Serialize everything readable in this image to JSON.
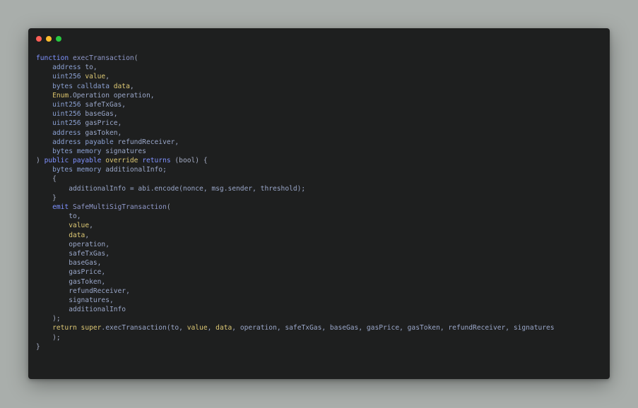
{
  "window": {
    "controls": {
      "close_color": "#ff5f57",
      "minimize_color": "#febc2e",
      "maximize_color": "#28c840"
    }
  },
  "code": {
    "lines": [
      [
        {
          "t": "kw",
          "v": "function "
        },
        {
          "t": "fn",
          "v": "execTransaction"
        },
        {
          "t": "punc",
          "v": "("
        }
      ],
      [
        {
          "t": "plain",
          "v": "    "
        },
        {
          "t": "type",
          "v": "address "
        },
        {
          "t": "plain",
          "v": "to,"
        }
      ],
      [
        {
          "t": "plain",
          "v": "    "
        },
        {
          "t": "type",
          "v": "uint256 "
        },
        {
          "t": "var",
          "v": "value"
        },
        {
          "t": "punc",
          "v": ","
        }
      ],
      [
        {
          "t": "plain",
          "v": "    "
        },
        {
          "t": "type",
          "v": "bytes calldata "
        },
        {
          "t": "var",
          "v": "data"
        },
        {
          "t": "punc",
          "v": ","
        }
      ],
      [
        {
          "t": "plain",
          "v": "    "
        },
        {
          "t": "class",
          "v": "Enum"
        },
        {
          "t": "plain",
          "v": ".Operation operation,"
        }
      ],
      [
        {
          "t": "plain",
          "v": "    "
        },
        {
          "t": "type",
          "v": "uint256 "
        },
        {
          "t": "plain",
          "v": "safeTxGas,"
        }
      ],
      [
        {
          "t": "plain",
          "v": "    "
        },
        {
          "t": "type",
          "v": "uint256 "
        },
        {
          "t": "plain",
          "v": "baseGas,"
        }
      ],
      [
        {
          "t": "plain",
          "v": "    "
        },
        {
          "t": "type",
          "v": "uint256 "
        },
        {
          "t": "plain",
          "v": "gasPrice,"
        }
      ],
      [
        {
          "t": "plain",
          "v": "    "
        },
        {
          "t": "type",
          "v": "address "
        },
        {
          "t": "plain",
          "v": "gasToken,"
        }
      ],
      [
        {
          "t": "plain",
          "v": "    "
        },
        {
          "t": "type",
          "v": "address payable "
        },
        {
          "t": "plain",
          "v": "refundReceiver,"
        }
      ],
      [
        {
          "t": "plain",
          "v": "    "
        },
        {
          "t": "type",
          "v": "bytes memory "
        },
        {
          "t": "plain",
          "v": "signatures"
        }
      ],
      [
        {
          "t": "punc",
          "v": ") "
        },
        {
          "t": "kw",
          "v": "public payable "
        },
        {
          "t": "var",
          "v": "override"
        },
        {
          "t": "kw",
          "v": " returns "
        },
        {
          "t": "punc",
          "v": "(bool) {"
        }
      ],
      [
        {
          "t": "plain",
          "v": "    "
        },
        {
          "t": "type",
          "v": "bytes memory "
        },
        {
          "t": "plain",
          "v": "additionalInfo;"
        }
      ],
      [
        {
          "t": "plain",
          "v": "    "
        },
        {
          "t": "punc",
          "v": "{"
        }
      ],
      [
        {
          "t": "plain",
          "v": "        additionalInfo = abi.encode(nonce, msg.sender, threshold);"
        }
      ],
      [
        {
          "t": "plain",
          "v": "    "
        },
        {
          "t": "punc",
          "v": "}"
        }
      ],
      [
        {
          "t": "plain",
          "v": "    "
        },
        {
          "t": "kw",
          "v": "emit "
        },
        {
          "t": "fn",
          "v": "SafeMultiSigTransaction"
        },
        {
          "t": "punc",
          "v": "("
        }
      ],
      [
        {
          "t": "plain",
          "v": "        to,"
        }
      ],
      [
        {
          "t": "plain",
          "v": "        "
        },
        {
          "t": "var",
          "v": "value"
        },
        {
          "t": "punc",
          "v": ","
        }
      ],
      [
        {
          "t": "plain",
          "v": "        "
        },
        {
          "t": "var",
          "v": "data"
        },
        {
          "t": "punc",
          "v": ","
        }
      ],
      [
        {
          "t": "plain",
          "v": "        operation,"
        }
      ],
      [
        {
          "t": "plain",
          "v": "        safeTxGas,"
        }
      ],
      [
        {
          "t": "plain",
          "v": "        baseGas,"
        }
      ],
      [
        {
          "t": "plain",
          "v": "        gasPrice,"
        }
      ],
      [
        {
          "t": "plain",
          "v": "        gasToken,"
        }
      ],
      [
        {
          "t": "plain",
          "v": "        refundReceiver,"
        }
      ],
      [
        {
          "t": "plain",
          "v": "        signatures,"
        }
      ],
      [
        {
          "t": "plain",
          "v": "        additionalInfo"
        }
      ],
      [
        {
          "t": "plain",
          "v": "    "
        },
        {
          "t": "punc",
          "v": ");"
        }
      ],
      [
        {
          "t": "plain",
          "v": "    "
        },
        {
          "t": "var",
          "v": "return super"
        },
        {
          "t": "plain",
          "v": ".execTransaction(to, "
        },
        {
          "t": "var",
          "v": "value"
        },
        {
          "t": "plain",
          "v": ", "
        },
        {
          "t": "var",
          "v": "data"
        },
        {
          "t": "plain",
          "v": ", operation, safeTxGas, baseGas, gasPrice, gasToken, refundReceiver, signatures"
        }
      ],
      [
        {
          "t": "plain",
          "v": "    "
        },
        {
          "t": "punc",
          "v": ");"
        }
      ],
      [
        {
          "t": "punc",
          "v": "}"
        }
      ]
    ]
  }
}
